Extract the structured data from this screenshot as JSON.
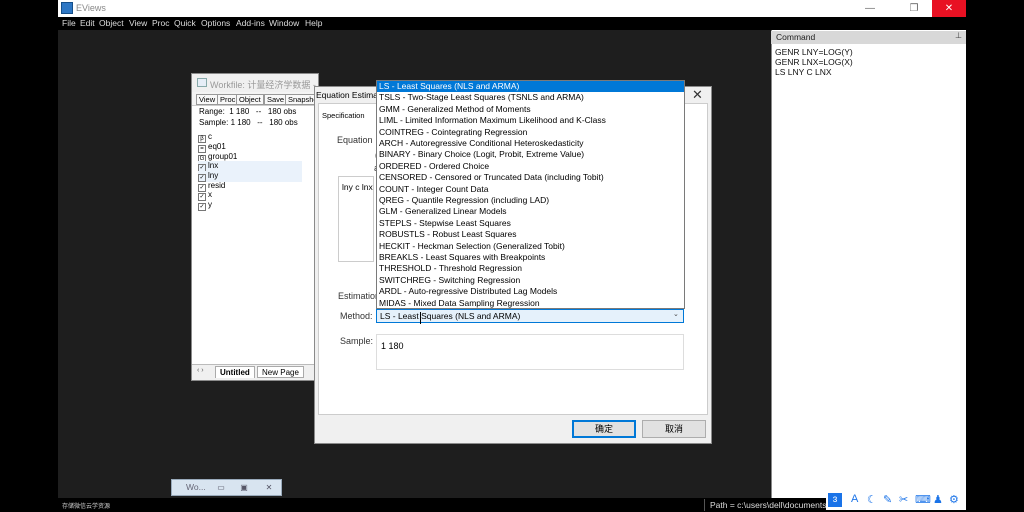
{
  "app": {
    "title": "EViews",
    "menu": [
      "File",
      "Edit",
      "Object",
      "View",
      "Proc",
      "Quick",
      "Options",
      "Add-ins",
      "Window",
      "Help"
    ],
    "window_controls": [
      "—",
      "❐",
      "✕"
    ]
  },
  "command": {
    "header": "Command",
    "pin": "⊥",
    "lines": [
      "GENR LNY=LOG(Y)",
      "GENR LNX=LOG(X)",
      "LS LNY C LNX"
    ]
  },
  "workfile": {
    "title": "Workfile: 计量经济学数据 - (c:\\users\\dell\\...",
    "toolbar": [
      "View",
      "Proc",
      "Object",
      "Save",
      "Snapshot"
    ],
    "range": "Range:  1 180   --   180 obs",
    "sample": "Sample: 1 180   --   180 obs",
    "items": [
      {
        "icon": "β",
        "name": "c"
      },
      {
        "icon": "=",
        "name": "eq01"
      },
      {
        "icon": "G",
        "name": "group01"
      },
      {
        "icon": "✓",
        "name": "lnx"
      },
      {
        "icon": "✓",
        "name": "lny"
      },
      {
        "icon": "✓",
        "name": "resid"
      },
      {
        "icon": "✓",
        "name": "x"
      },
      {
        "icon": "✓",
        "name": "y"
      }
    ],
    "tabs": [
      "Untitled",
      "New Page"
    ],
    "nav": "‹  ›"
  },
  "dialog": {
    "title": "Equation Estimation",
    "tab": "Specification",
    "equation_label": "Equation",
    "equation_text": "lny c lnx",
    "side_labels": [
      "(E",
      "a"
    ],
    "estimation_label": "Estimation settings",
    "method_label": "Method:",
    "method_value": "LS  -  Least Squares (NLS and ARMA)",
    "method_arrow": "⌄",
    "sample_label": "Sample:",
    "sample_value": "1 180",
    "ok": "确定",
    "cancel": "取消",
    "close": "✕"
  },
  "methods": [
    "LS  -  Least Squares (NLS and ARMA)",
    "TSLS  -  Two-Stage Least Squares (TSNLS and ARMA)",
    "GMM  -  Generalized Method of Moments",
    "LIML  -  Limited Information Maximum Likelihood and K-Class",
    "COINTREG  -  Cointegrating Regression",
    "ARCH  -  Autoregressive Conditional Heteroskedasticity",
    "BINARY  -  Binary Choice (Logit, Probit, Extreme Value)",
    "ORDERED  -  Ordered Choice",
    "CENSORED  -  Censored or Truncated Data (including Tobit)",
    "COUNT  -  Integer Count Data",
    "QREG  -  Quantile Regression (including LAD)",
    "GLM  -  Generalized Linear Models",
    "STEPLS  -  Stepwise Least Squares",
    "ROBUSTLS  -  Robust Least Squares",
    "HECKIT  -  Heckman Selection (Generalized Tobit)",
    "BREAKLS  -  Least Squares with Breakpoints",
    "THRESHOLD  -  Threshold Regression",
    "SWITCHREG  -  Switching Regression",
    "ARDL  -  Auto-regressive Distributed Lag Models",
    "MIDAS  -  Mixed Data Sampling Regression"
  ],
  "minimized": {
    "title": "Wo..."
  },
  "status": {
    "left": "存储微信云学资源",
    "path": "Path  =  c:\\users\\dell\\documents"
  }
}
